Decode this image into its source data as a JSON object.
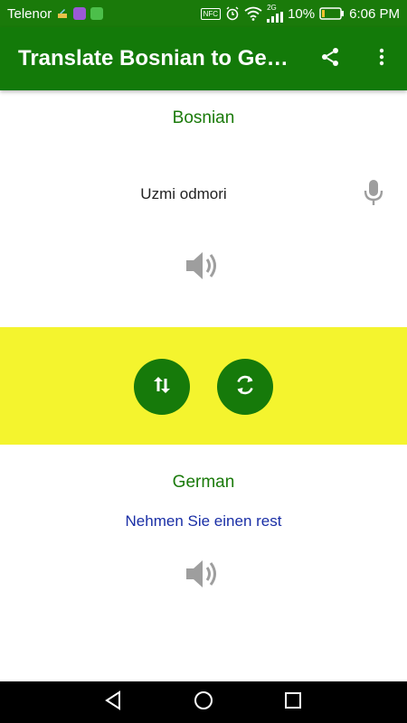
{
  "status_bar": {
    "carrier": "Telenor",
    "network": "2G",
    "battery": "10%",
    "time": "6:06 PM",
    "nfc_label": "NFC",
    "icons": [
      "clean-icon",
      "app-icon",
      "download-icon",
      "nfc-icon",
      "alarm-icon",
      "wifi-icon",
      "signal-icon",
      "battery-icon"
    ]
  },
  "app_bar": {
    "title": "Translate Bosnian to German",
    "share_icon": "share-icon",
    "more_icon": "more-vert-icon"
  },
  "source": {
    "language": "Bosnian",
    "text": "Uzmi odmori",
    "mic_icon": "microphone-icon",
    "speaker_icon": "speaker-icon"
  },
  "actions": {
    "swap_icon": "swap-vertical-icon",
    "refresh_icon": "refresh-icon",
    "band_color": "#f4f42e"
  },
  "target": {
    "language": "German",
    "text": "Nehmen Sie einen rest",
    "speaker_icon": "speaker-icon"
  },
  "colors": {
    "primary": "#137a09",
    "language_label": "#1a7a0a",
    "translation_text": "#1a2fa6",
    "icon_gray": "#9e9e9e"
  },
  "nav_bar": {
    "icons": [
      "back-icon",
      "home-icon",
      "recent-apps-icon"
    ]
  }
}
